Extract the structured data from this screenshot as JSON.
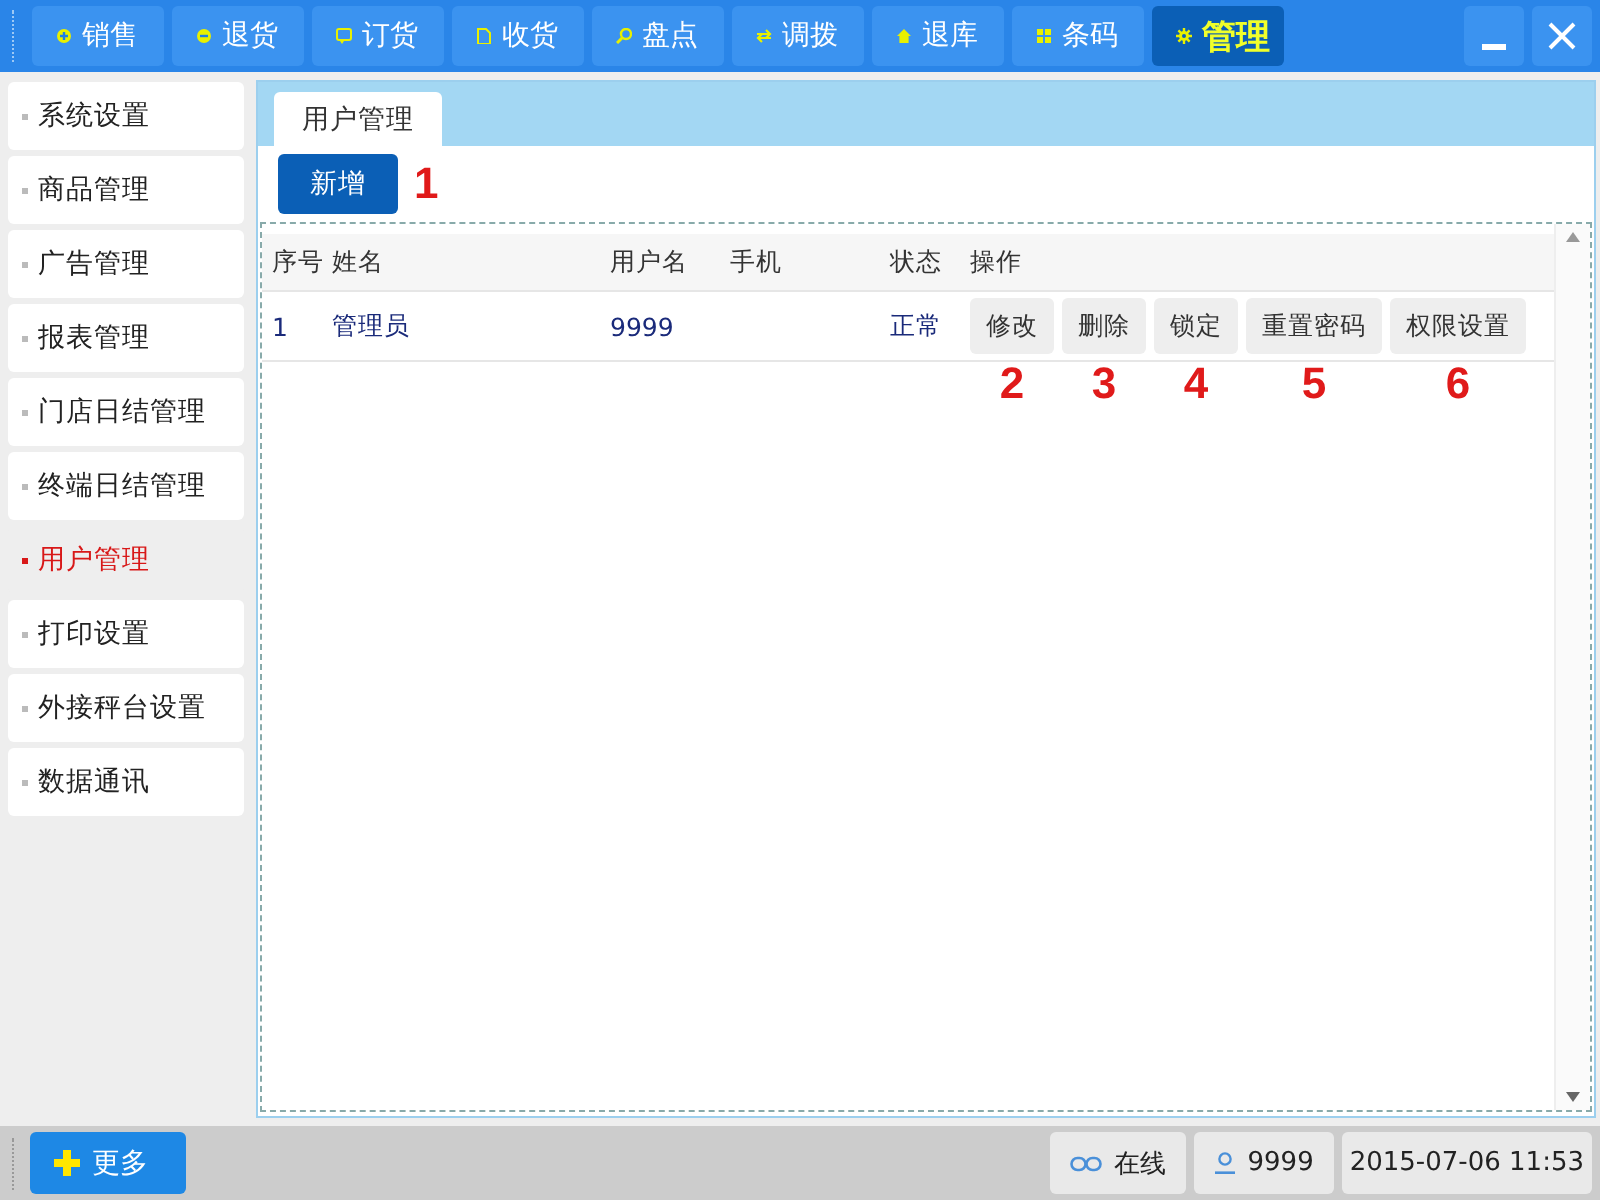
{
  "toolbar": {
    "tabs": [
      {
        "label": "销售",
        "selected": false
      },
      {
        "label": "退货",
        "selected": false
      },
      {
        "label": "订货",
        "selected": false
      },
      {
        "label": "收货",
        "selected": false
      },
      {
        "label": "盘点",
        "selected": false
      },
      {
        "label": "调拨",
        "selected": false
      },
      {
        "label": "退库",
        "selected": false
      },
      {
        "label": "条码",
        "selected": false
      },
      {
        "label": "管理",
        "selected": true
      }
    ]
  },
  "sidebar": {
    "items": [
      {
        "label": "系统设置",
        "selected": false
      },
      {
        "label": "商品管理",
        "selected": false
      },
      {
        "label": "广告管理",
        "selected": false
      },
      {
        "label": "报表管理",
        "selected": false
      },
      {
        "label": "门店日结管理",
        "selected": false
      },
      {
        "label": "终端日结管理",
        "selected": false
      },
      {
        "label": "用户管理",
        "selected": true
      },
      {
        "label": "打印设置",
        "selected": false
      },
      {
        "label": "外接秤台设置",
        "selected": false
      },
      {
        "label": "数据通讯",
        "selected": false
      }
    ]
  },
  "main": {
    "tabs": [
      {
        "label": "用户管理",
        "selected": true
      }
    ],
    "add_button": {
      "label": "新增",
      "annotation": "1"
    },
    "table": {
      "columns": [
        "序号",
        "姓名",
        "用户名",
        "手机",
        "状态",
        "操作"
      ],
      "rows": [
        {
          "index": "1",
          "name": "管理员",
          "username": "9999",
          "status": "正常",
          "actions": [
            {
              "label": "修改",
              "annotation": "2"
            },
            {
              "label": "删除",
              "annotation": "3"
            },
            {
              "label": "锁定",
              "annotation": "4"
            },
            {
              "label": "重置密码",
              "annotation": "5"
            },
            {
              "label": "权限设置",
              "annotation": "6"
            }
          ]
        }
      ]
    }
  },
  "status_bar": {
    "more_button": "更多",
    "connection": "在线",
    "user": "9999",
    "datetime": "2015-07-06 11:53"
  }
}
